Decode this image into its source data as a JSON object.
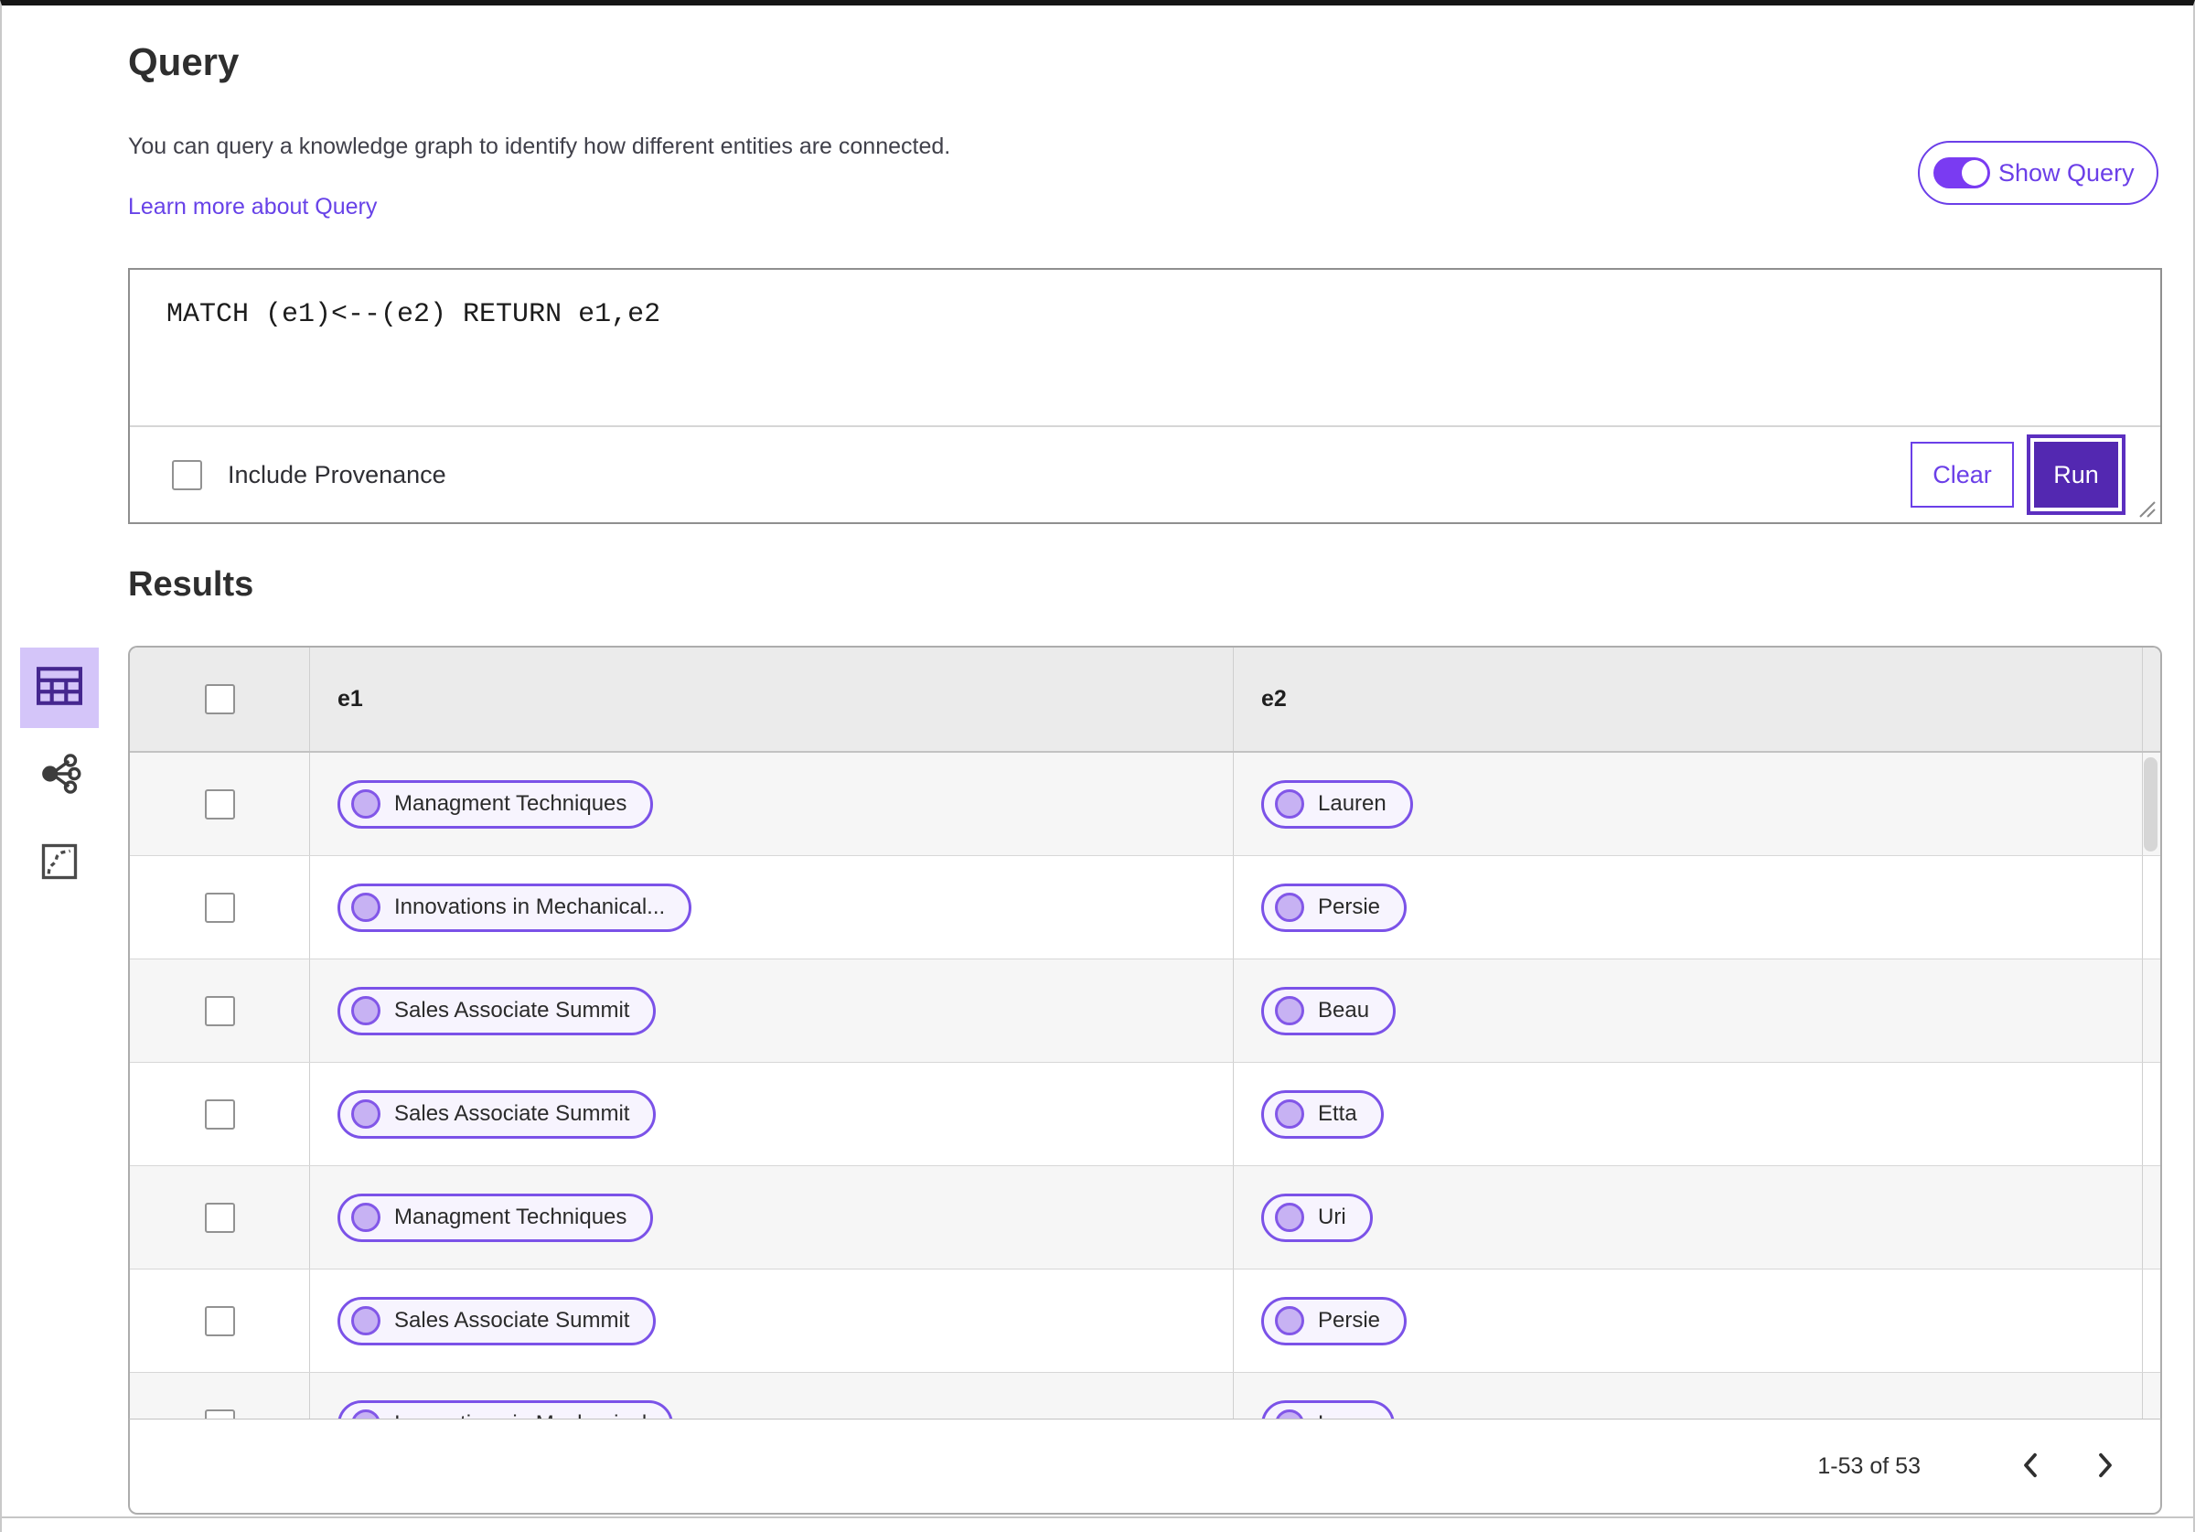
{
  "query_panel": {
    "title": "Query",
    "description": "You can query a knowledge graph to identify how different entities are connected.",
    "learn_more_link": "Learn more about Query",
    "show_query_toggle": {
      "label": "Show Query",
      "state": "on"
    },
    "editor": {
      "value": "MATCH (e1)<--(e2) RETURN e1,e2"
    },
    "include_provenance": {
      "label": "Include Provenance",
      "checked": false
    },
    "buttons": {
      "clear": "Clear",
      "run": "Run"
    }
  },
  "results_panel": {
    "title": "Results",
    "view_switcher": [
      {
        "name": "table-view",
        "icon": "table-icon",
        "selected": true
      },
      {
        "name": "graph-view",
        "icon": "network-icon",
        "selected": false
      },
      {
        "name": "path-view",
        "icon": "route-icon",
        "selected": false
      }
    ],
    "table": {
      "columns": [
        "e1",
        "e2"
      ],
      "rows": [
        {
          "e1": "Managment Techniques",
          "e2": "Lauren"
        },
        {
          "e1": "Innovations in Mechanical...",
          "e2": "Persie"
        },
        {
          "e1": "Sales Associate Summit",
          "e2": "Beau"
        },
        {
          "e1": "Sales Associate Summit",
          "e2": "Etta"
        },
        {
          "e1": "Managment Techniques",
          "e2": "Uri"
        },
        {
          "e1": "Sales Associate Summit",
          "e2": "Persie"
        },
        {
          "e1": "Innovations in Mechanical",
          "e2": "Larry"
        }
      ]
    },
    "pagination": {
      "range_label": "1-53 of 53"
    }
  },
  "colors": {
    "accent_purple": "#6B3FE8",
    "toggle_track": "#7A3BF2",
    "run_button_fill": "#5328B1",
    "selected_tile_bg": "#D4C5F9",
    "pill_border": "#7B52E8",
    "pill_bg": "#F7F4FE",
    "pill_dot_fill": "#C7B2F3",
    "header_row_bg": "#EBEBEB",
    "alt_row_bg": "#F6F6F6"
  }
}
